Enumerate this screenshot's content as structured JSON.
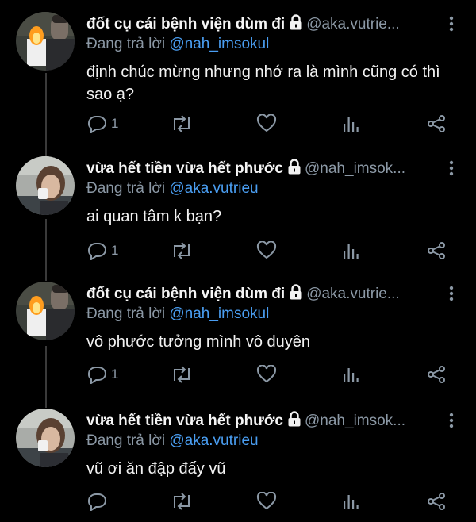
{
  "tweets": [
    {
      "name": "đốt cụ cái bệnh viện dùm đi",
      "handle": "@aka.vutrie...",
      "reply_prefix": "Đang trả lời",
      "reply_to": "@nah_imsokul",
      "text": "định chúc mừng nhưng nhớ ra là mình cũng có thì sao ạ?",
      "reply_count": "1",
      "avatar": "avatar-candle-photo"
    },
    {
      "name": "vừa hết tiền vừa hết phước",
      "handle": "@nah_imsok...",
      "reply_prefix": "Đang trả lời",
      "reply_to": "@aka.vutrieu",
      "text": "ai quan tâm k bạn?",
      "reply_count": "1",
      "avatar": "avatar-woman-photo"
    },
    {
      "name": "đốt cụ cái bệnh viện dùm đi",
      "handle": "@aka.vutrie...",
      "reply_prefix": "Đang trả lời",
      "reply_to": "@nah_imsokul",
      "text": "vô phước tưởng mình vô duyên",
      "reply_count": "1",
      "avatar": "avatar-candle-photo"
    },
    {
      "name": "vừa hết tiền vừa hết phước",
      "handle": "@nah_imsok...",
      "reply_prefix": "Đang trả lời",
      "reply_to": "@aka.vutrieu",
      "text": "vũ ơi ăn đập đấy vũ",
      "reply_count": "",
      "avatar": "avatar-woman-photo"
    }
  ],
  "icons": {
    "reply": "reply-icon",
    "retweet": "retweet-icon",
    "like": "heart-icon",
    "analytics": "analytics-icon",
    "share": "share-icon",
    "lock": "lock-icon",
    "more": "more-vertical-icon"
  },
  "colors": {
    "background": "#000000",
    "text": "#f2f2f2",
    "muted": "#8b98a5",
    "mention": "#4a9ef2",
    "thread_line": "#3a3a3a"
  }
}
